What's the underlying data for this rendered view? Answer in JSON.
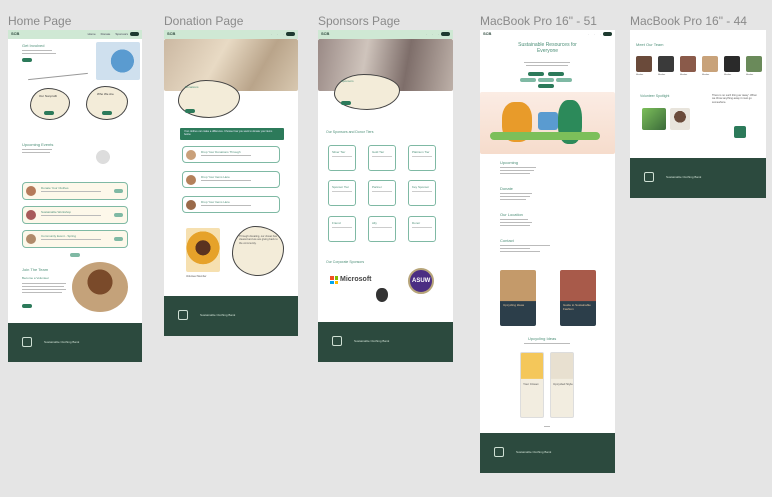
{
  "frames": {
    "home": {
      "label": "Home Page",
      "hero_title": "Get Involved",
      "nav_links": [
        "Home",
        "Donate",
        "Sponsors",
        "About"
      ],
      "blob_left_title": "Our Nonprofit",
      "blob_right_title": "Who We Are",
      "section_title": "Upcoming Events",
      "events": [
        "Donate Your Clothes",
        "Sustainable Workshop",
        "Community Event - Spring"
      ],
      "join_title": "Join The Team",
      "join_sub": "Become a Volunteer",
      "footer_text": "Sustainable Clothing Bank"
    },
    "donation": {
      "label": "Donation Page",
      "intro_title": "Donations",
      "banner_text": "Your clothes can make a difference. Choose how you want to donate your items below.",
      "options": [
        "Drop Your Donations Through",
        "Drop Your Items Here",
        "Drop Your Items Here"
      ],
      "quote": "Through donating, our closet has cleared and we are giving back to the community.",
      "quote_author": "Volunteer Member",
      "footer_text": "Sustainable Clothing Bank"
    },
    "sponsors": {
      "label": "Sponsors Page",
      "intro_title": "Sponsors",
      "grid_title": "Our Sponsors and Donor Tiers",
      "tiers": [
        "Silver Tier",
        "Gold Tier",
        "Platinum Tier",
        "Sponsor Tier",
        "Partner",
        "Key Sponsor",
        "Friend",
        "Ally",
        "Donor"
      ],
      "logos_title": "Our Corporate Sponsors",
      "logo_microsoft": "Microsoft",
      "logo_asuw": "ASUW",
      "footer_text": "Sustainable Clothing Bank"
    },
    "macbook51": {
      "label": "MacBook Pro 16\" - 51",
      "hero_title": "Sustainable Resources for Everyone",
      "section_events": "Upcoming",
      "section_donate": "Donate",
      "section_location": "Our Location",
      "section_contact": "Contact",
      "book1_title": "Upcycling Ideas",
      "book2_title": "Guide to Sustainable Fashion",
      "section_reading": "Upcycling Ideas",
      "book3_title": "Your Closet",
      "book4_title": "Upcycled Style",
      "footer_text": "Sustainable Clothing Bank"
    },
    "macbook44": {
      "label": "MacBook Pro 16\" - 44",
      "team_title": "Meet Our Team",
      "team": [
        "Member",
        "Member",
        "Member",
        "Member",
        "Member",
        "Member"
      ],
      "story_title": "Volunteer Spotlight",
      "quote": "There is no such thing as 'away'. When we throw anything away it must go somewhere.",
      "footer_text": "Sustainable Clothing Bank"
    }
  },
  "colors": {
    "nav": "#cfe8d4",
    "footer": "#2c4a3e",
    "accent": "#4d8f78",
    "button": "#2c7a5a",
    "canvas": "#e5e5e5"
  }
}
